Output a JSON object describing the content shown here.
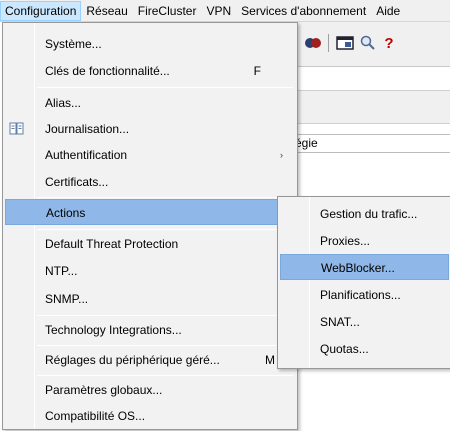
{
  "menubar": {
    "items": [
      {
        "label": "Configuration",
        "active": true
      },
      {
        "label": "Réseau"
      },
      {
        "label": "FireCluster"
      },
      {
        "label": "VPN"
      },
      {
        "label": "Services d'abonnement"
      },
      {
        "label": "Aide"
      }
    ]
  },
  "background": {
    "column_header": "atégie"
  },
  "menu": {
    "items": [
      {
        "label": "Système..."
      },
      {
        "label": "Clés de fonctionnalité...",
        "shortcut": "F"
      },
      {
        "label": "Alias..."
      },
      {
        "label": "Journalisation...",
        "icon": "log-icon"
      },
      {
        "label": "Authentification",
        "submenu": true
      },
      {
        "label": "Certificats..."
      },
      {
        "label": "Actions",
        "submenu": true,
        "highlighted": true
      },
      {
        "label": "Default Threat Protection",
        "submenu": true
      },
      {
        "label": "NTP..."
      },
      {
        "label": "SNMP..."
      },
      {
        "label": "Technology Integrations..."
      },
      {
        "label": "Réglages du périphérique géré...",
        "shortcut": "M"
      },
      {
        "label": "Paramètres globaux..."
      },
      {
        "label": "Compatibilité OS..."
      }
    ],
    "submenu_arrow": "›"
  },
  "submenu": {
    "items": [
      {
        "label": "Gestion du trafic..."
      },
      {
        "label": "Proxies..."
      },
      {
        "label": "WebBlocker...",
        "highlighted": true
      },
      {
        "label": "Planifications..."
      },
      {
        "label": "SNAT..."
      },
      {
        "label": "Quotas..."
      }
    ]
  },
  "colors": {
    "menubar_bg": "#f0f0f0",
    "menu_bg": "#f2f2f2",
    "highlight": "#8fb8e8",
    "active_menubar": "#cce8ff"
  }
}
